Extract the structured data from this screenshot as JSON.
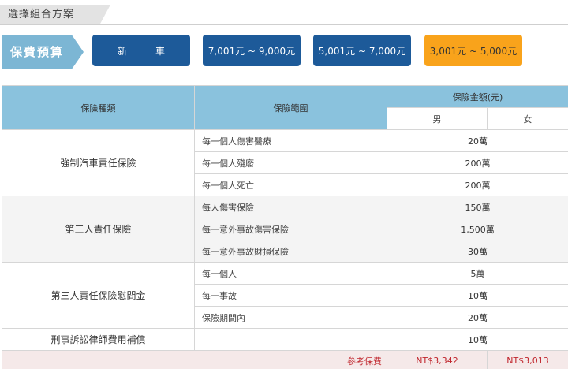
{
  "header": {
    "title": "選擇組合方案"
  },
  "budget": {
    "label": "保費預算",
    "options": [
      {
        "label": "新　車",
        "active": false
      },
      {
        "label": "7,001元 ~ 9,000元",
        "active": false
      },
      {
        "label": "5,001元 ~ 7,000元",
        "active": false
      },
      {
        "label": "3,001元 ~ 5,000元",
        "active": true
      }
    ],
    "active_color": "#f9a31b",
    "button_color": "#1d5a99"
  },
  "table": {
    "headers": {
      "type": "保險種類",
      "scope": "保險範圍",
      "amount": "保險金額(元)",
      "male": "男",
      "female": "女"
    },
    "groups": [
      {
        "category": "強制汽車責任保險",
        "rows": [
          {
            "coverage": "每一個人傷害醫療",
            "amount": "20萬"
          },
          {
            "coverage": "每一個人殘廢",
            "amount": "200萬"
          },
          {
            "coverage": "每一個人死亡",
            "amount": "200萬"
          }
        ]
      },
      {
        "category": "第三人責任保險",
        "rows": [
          {
            "coverage": "每人傷害保險",
            "amount": "150萬"
          },
          {
            "coverage": "每一意外事故傷害保險",
            "amount": "1,500萬"
          },
          {
            "coverage": "每一意外事故財損保險",
            "amount": "30萬"
          }
        ]
      },
      {
        "category": "第三人責任保險慰問金",
        "rows": [
          {
            "coverage": "每一個人",
            "amount": "5萬"
          },
          {
            "coverage": "每一事故",
            "amount": "10萬"
          },
          {
            "coverage": "保險期間內",
            "amount": "20萬"
          }
        ]
      },
      {
        "category": "刑事訴訟律師費用補償",
        "rows": [
          {
            "coverage": "",
            "amount": "10萬"
          }
        ]
      }
    ],
    "footer": {
      "label": "參考保費",
      "male": "NT$3,342",
      "female": "NT$3,013"
    }
  }
}
